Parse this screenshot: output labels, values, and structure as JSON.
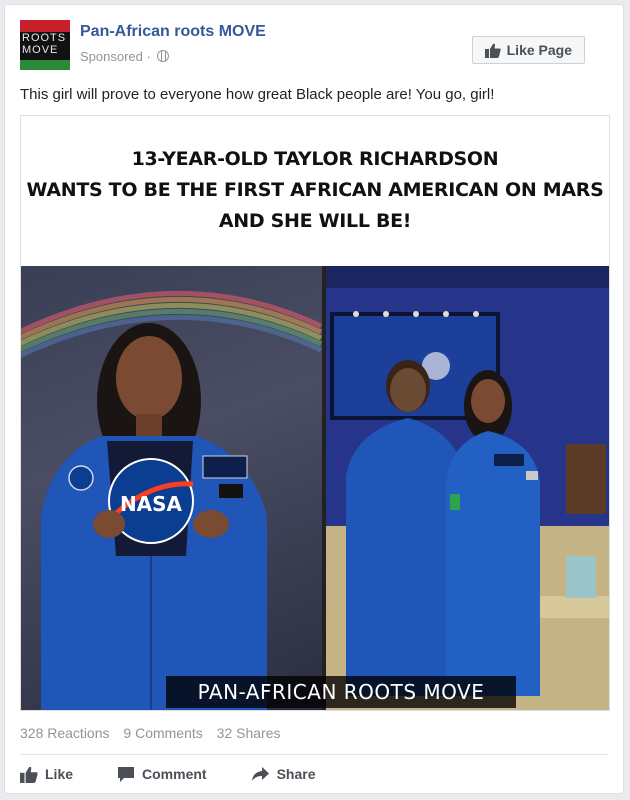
{
  "page": {
    "name": "Pan-African roots MOVE",
    "sponsored": "Sponsored ·",
    "avatar_text": "ROOTS MOVE",
    "like_page_button": "Like Page"
  },
  "post": {
    "text": "This girl will prove to everyone how great Black people are! You go, girl!",
    "headline_lines": [
      "13-YEAR-OLD TAYLOR RICHARDSON",
      "WANTS TO BE THE FIRST AFRICAN AMERICAN ON MARS",
      "AND SHE WILL BE!"
    ],
    "image_caption": "PAN-AFRICAN ROOTS MOVE",
    "shirt_text": "NASA"
  },
  "stats": {
    "reactions": "328 Reactions",
    "comments": "9 Comments",
    "shares": "32 Shares"
  },
  "actions": {
    "like": "Like",
    "comment": "Comment",
    "share": "Share"
  },
  "colors": {
    "link": "#365899",
    "muted": "#90949c",
    "action": "#4b4f56",
    "flight_suit": "#1f56b8"
  },
  "icons": [
    "globe-icon",
    "thumbs-up-icon",
    "comment-icon",
    "share-icon"
  ]
}
